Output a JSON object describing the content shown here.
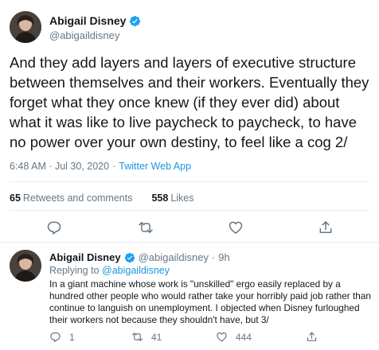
{
  "main_tweet": {
    "name": "Abigail Disney",
    "handle": "@abigaildisney",
    "text": "And they add layers and layers of executive structure between themselves and their workers.  Eventually they forget what they once knew (if they ever did) about what it was like to live paycheck to paycheck, to have no power over your own destiny, to feel like a cog 2/",
    "timestamp": "6:48 AM · Jul 30, 2020",
    "separator": "·",
    "source": "Twitter Web App",
    "retweets_count": "65",
    "retweets_label": "Retweets and comments",
    "likes_count": "558",
    "likes_label": "Likes",
    "action_icons": [
      "reply-icon",
      "retweet-icon",
      "like-icon",
      "share-icon"
    ]
  },
  "reply_tweet": {
    "name": "Abigail Disney",
    "handle": "@abigaildisney",
    "dot": "·",
    "time": "9h",
    "replying_prefix": "Replying to",
    "replying_to": "@abigaildisney",
    "text": "In a giant machine whose work is \"unskilled\" ergo easily replaced by a hundred other people who would rather take your horribly paid job rather than continue to languish on unemployment.  I objected when Disney furloughed their workers not because they shouldn't have, but 3/",
    "reply_count": "1",
    "retweet_count": "41",
    "like_count": "444"
  },
  "colors": {
    "accent": "#1b95e0",
    "verified": "#1da1f2",
    "muted": "#657786",
    "text": "#14171a",
    "divider": "#e6ecf0"
  }
}
